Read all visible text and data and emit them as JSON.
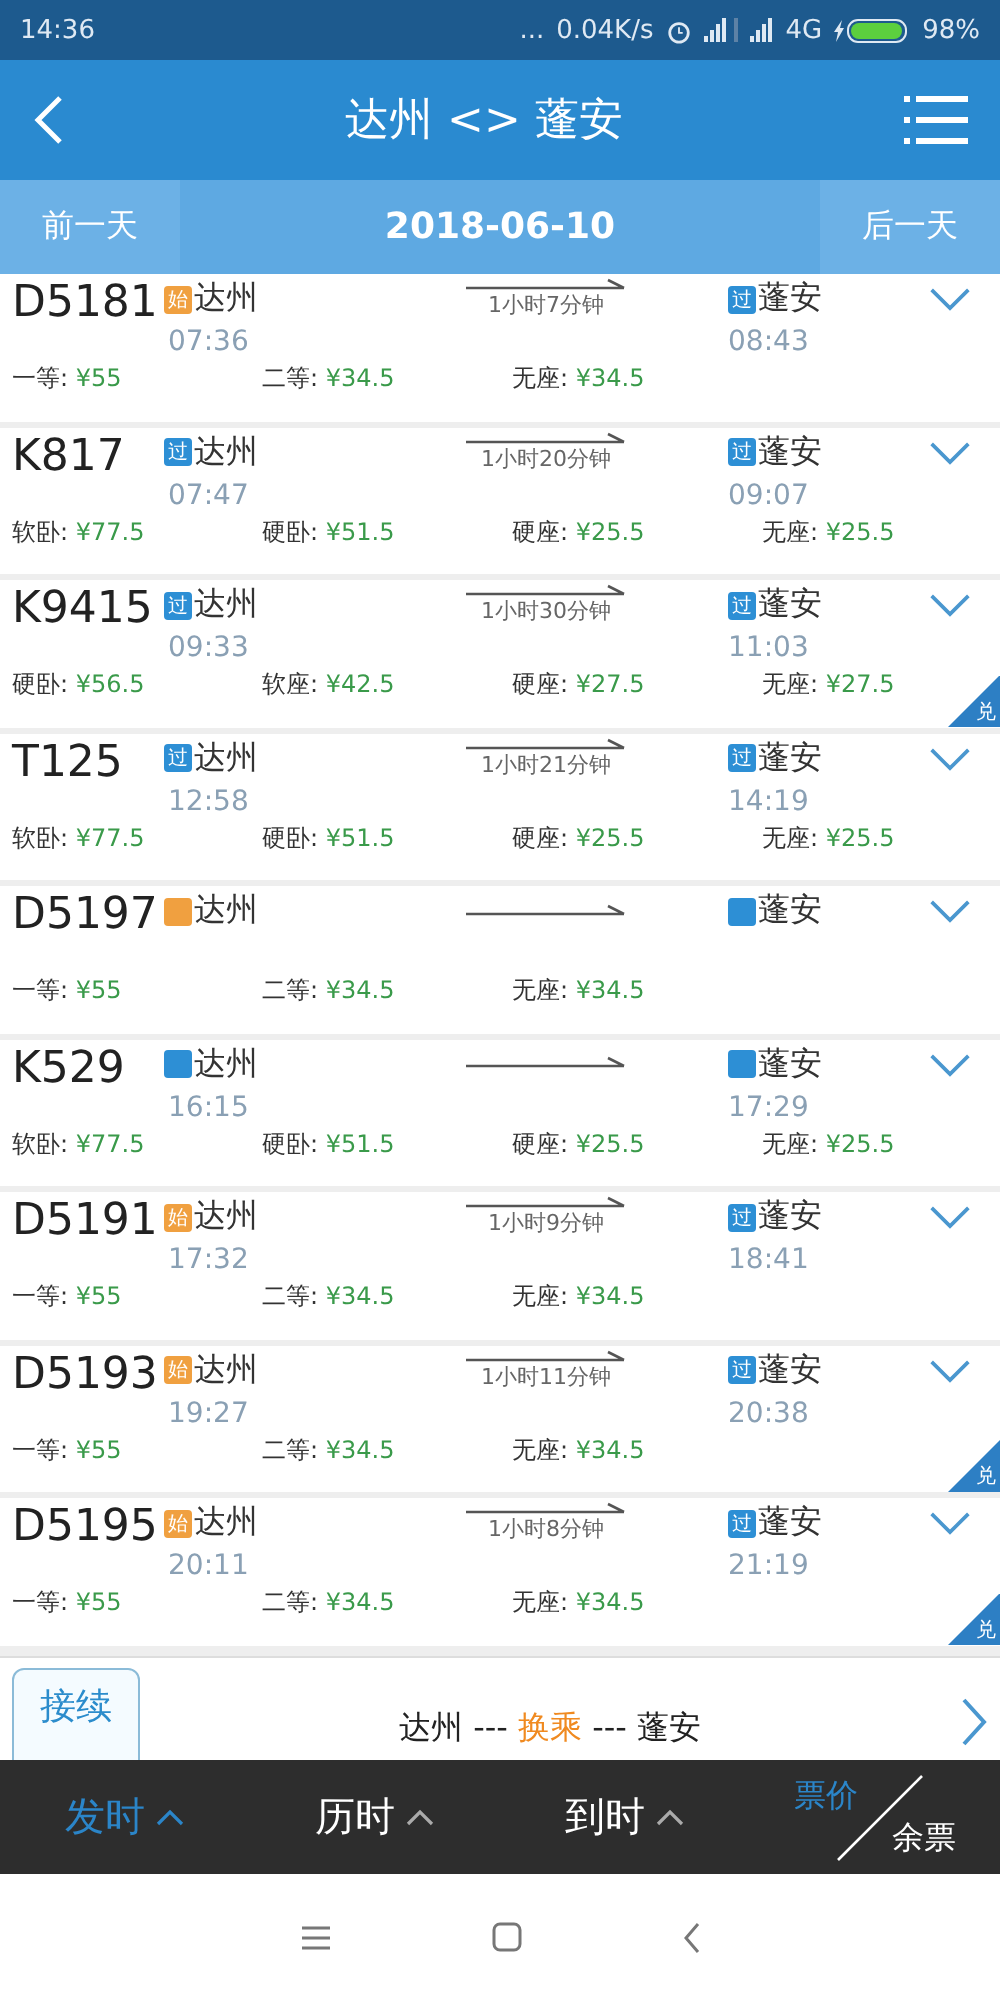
{
  "status_bar": {
    "time": "14:36",
    "dots": "...",
    "speed": "0.04K/s",
    "network": "4G",
    "battery": "98%"
  },
  "header": {
    "title": "达州 <> 蓬安"
  },
  "date_bar": {
    "prev": "前一天",
    "date": "2018-06-10",
    "next": "后一天"
  },
  "trains": [
    {
      "number": "D5181",
      "from": {
        "badge": "始",
        "kind": "start",
        "station": "达州",
        "time": "07:36"
      },
      "duration": "1小时7分钟",
      "to": {
        "badge": "过",
        "kind": "pass",
        "station": "蓬安",
        "time": "08:43"
      },
      "prices": [
        {
          "seat": "一等:",
          "price": "¥55"
        },
        {
          "seat": "二等:",
          "price": "¥34.5"
        },
        {
          "seat": "无座:",
          "price": "¥34.5"
        }
      ]
    },
    {
      "number": "K817",
      "from": {
        "badge": "过",
        "kind": "pass",
        "station": "达州",
        "time": "07:47"
      },
      "duration": "1小时20分钟",
      "to": {
        "badge": "过",
        "kind": "pass",
        "station": "蓬安",
        "time": "09:07"
      },
      "prices": [
        {
          "seat": "软卧:",
          "price": "¥77.5"
        },
        {
          "seat": "硬卧:",
          "price": "¥51.5"
        },
        {
          "seat": "硬座:",
          "price": "¥25.5"
        },
        {
          "seat": "无座:",
          "price": "¥25.5"
        }
      ]
    },
    {
      "number": "K9415",
      "from": {
        "badge": "过",
        "kind": "pass",
        "station": "达州",
        "time": "09:33"
      },
      "duration": "1小时30分钟",
      "to": {
        "badge": "过",
        "kind": "pass",
        "station": "蓬安",
        "time": "11:03"
      },
      "prices": [
        {
          "seat": "硬卧:",
          "price": "¥56.5"
        },
        {
          "seat": "软座:",
          "price": "¥42.5"
        },
        {
          "seat": "硬座:",
          "price": "¥27.5"
        },
        {
          "seat": "无座:",
          "price": "¥27.5"
        }
      ],
      "corner_tag": "兑"
    },
    {
      "number": "T125",
      "from": {
        "badge": "过",
        "kind": "pass",
        "station": "达州",
        "time": "12:58"
      },
      "duration": "1小时21分钟",
      "to": {
        "badge": "过",
        "kind": "pass",
        "station": "蓬安",
        "time": "14:19"
      },
      "prices": [
        {
          "seat": "软卧:",
          "price": "¥77.5"
        },
        {
          "seat": "硬卧:",
          "price": "¥51.5"
        },
        {
          "seat": "硬座:",
          "price": "¥25.5"
        },
        {
          "seat": "无座:",
          "price": "¥25.5"
        }
      ]
    },
    {
      "number": "D5197",
      "from": {
        "kind": "start",
        "station": "达州"
      },
      "to": {
        "kind": "pass",
        "station": "蓬安"
      },
      "prices": [
        {
          "seat": "一等:",
          "price": "¥55"
        },
        {
          "seat": "二等:",
          "price": "¥34.5"
        },
        {
          "seat": "无座:",
          "price": "¥34.5"
        }
      ]
    },
    {
      "number": "K529",
      "from": {
        "kind": "pass",
        "station": "达州",
        "time": "16:15"
      },
      "to": {
        "kind": "pass",
        "station": "蓬安",
        "time": "17:29"
      },
      "prices": [
        {
          "seat": "软卧:",
          "price": "¥77.5"
        },
        {
          "seat": "硬卧:",
          "price": "¥51.5"
        },
        {
          "seat": "硬座:",
          "price": "¥25.5"
        },
        {
          "seat": "无座:",
          "price": "¥25.5"
        }
      ]
    },
    {
      "number": "D5191",
      "from": {
        "badge": "始",
        "kind": "start",
        "station": "达州",
        "time": "17:32"
      },
      "duration": "1小时9分钟",
      "to": {
        "badge": "过",
        "kind": "pass",
        "station": "蓬安",
        "time": "18:41"
      },
      "prices": [
        {
          "seat": "一等:",
          "price": "¥55"
        },
        {
          "seat": "二等:",
          "price": "¥34.5"
        },
        {
          "seat": "无座:",
          "price": "¥34.5"
        }
      ]
    },
    {
      "number": "D5193",
      "from": {
        "badge": "始",
        "kind": "start",
        "station": "达州",
        "time": "19:27"
      },
      "duration": "1小时11分钟",
      "to": {
        "badge": "过",
        "kind": "pass",
        "station": "蓬安",
        "time": "20:38"
      },
      "prices": [
        {
          "seat": "一等:",
          "price": "¥55"
        },
        {
          "seat": "二等:",
          "price": "¥34.5"
        },
        {
          "seat": "无座:",
          "price": "¥34.5"
        }
      ],
      "corner_tag": "兑"
    },
    {
      "number": "D5195",
      "from": {
        "badge": "始",
        "kind": "start",
        "station": "达州",
        "time": "20:11"
      },
      "duration": "1小时8分钟",
      "to": {
        "badge": "过",
        "kind": "pass",
        "station": "蓬安",
        "time": "21:19"
      },
      "prices": [
        {
          "seat": "一等:",
          "price": "¥55"
        },
        {
          "seat": "二等:",
          "price": "¥34.5"
        },
        {
          "seat": "无座:",
          "price": "¥34.5"
        }
      ],
      "corner_tag": "兑"
    }
  ],
  "transfer": {
    "button": "接续",
    "from": "达州",
    "sep1": "---",
    "via": "换乘",
    "sep2": "---",
    "to": "蓬安"
  },
  "sort_bar": [
    {
      "kind": "sort",
      "label": "发时",
      "selected": true
    },
    {
      "kind": "sort",
      "label": "历时",
      "selected": false
    },
    {
      "kind": "sort",
      "label": "到时",
      "selected": false
    },
    {
      "kind": "split",
      "top": "票价",
      "bottom": "余票",
      "selected": true
    }
  ]
}
